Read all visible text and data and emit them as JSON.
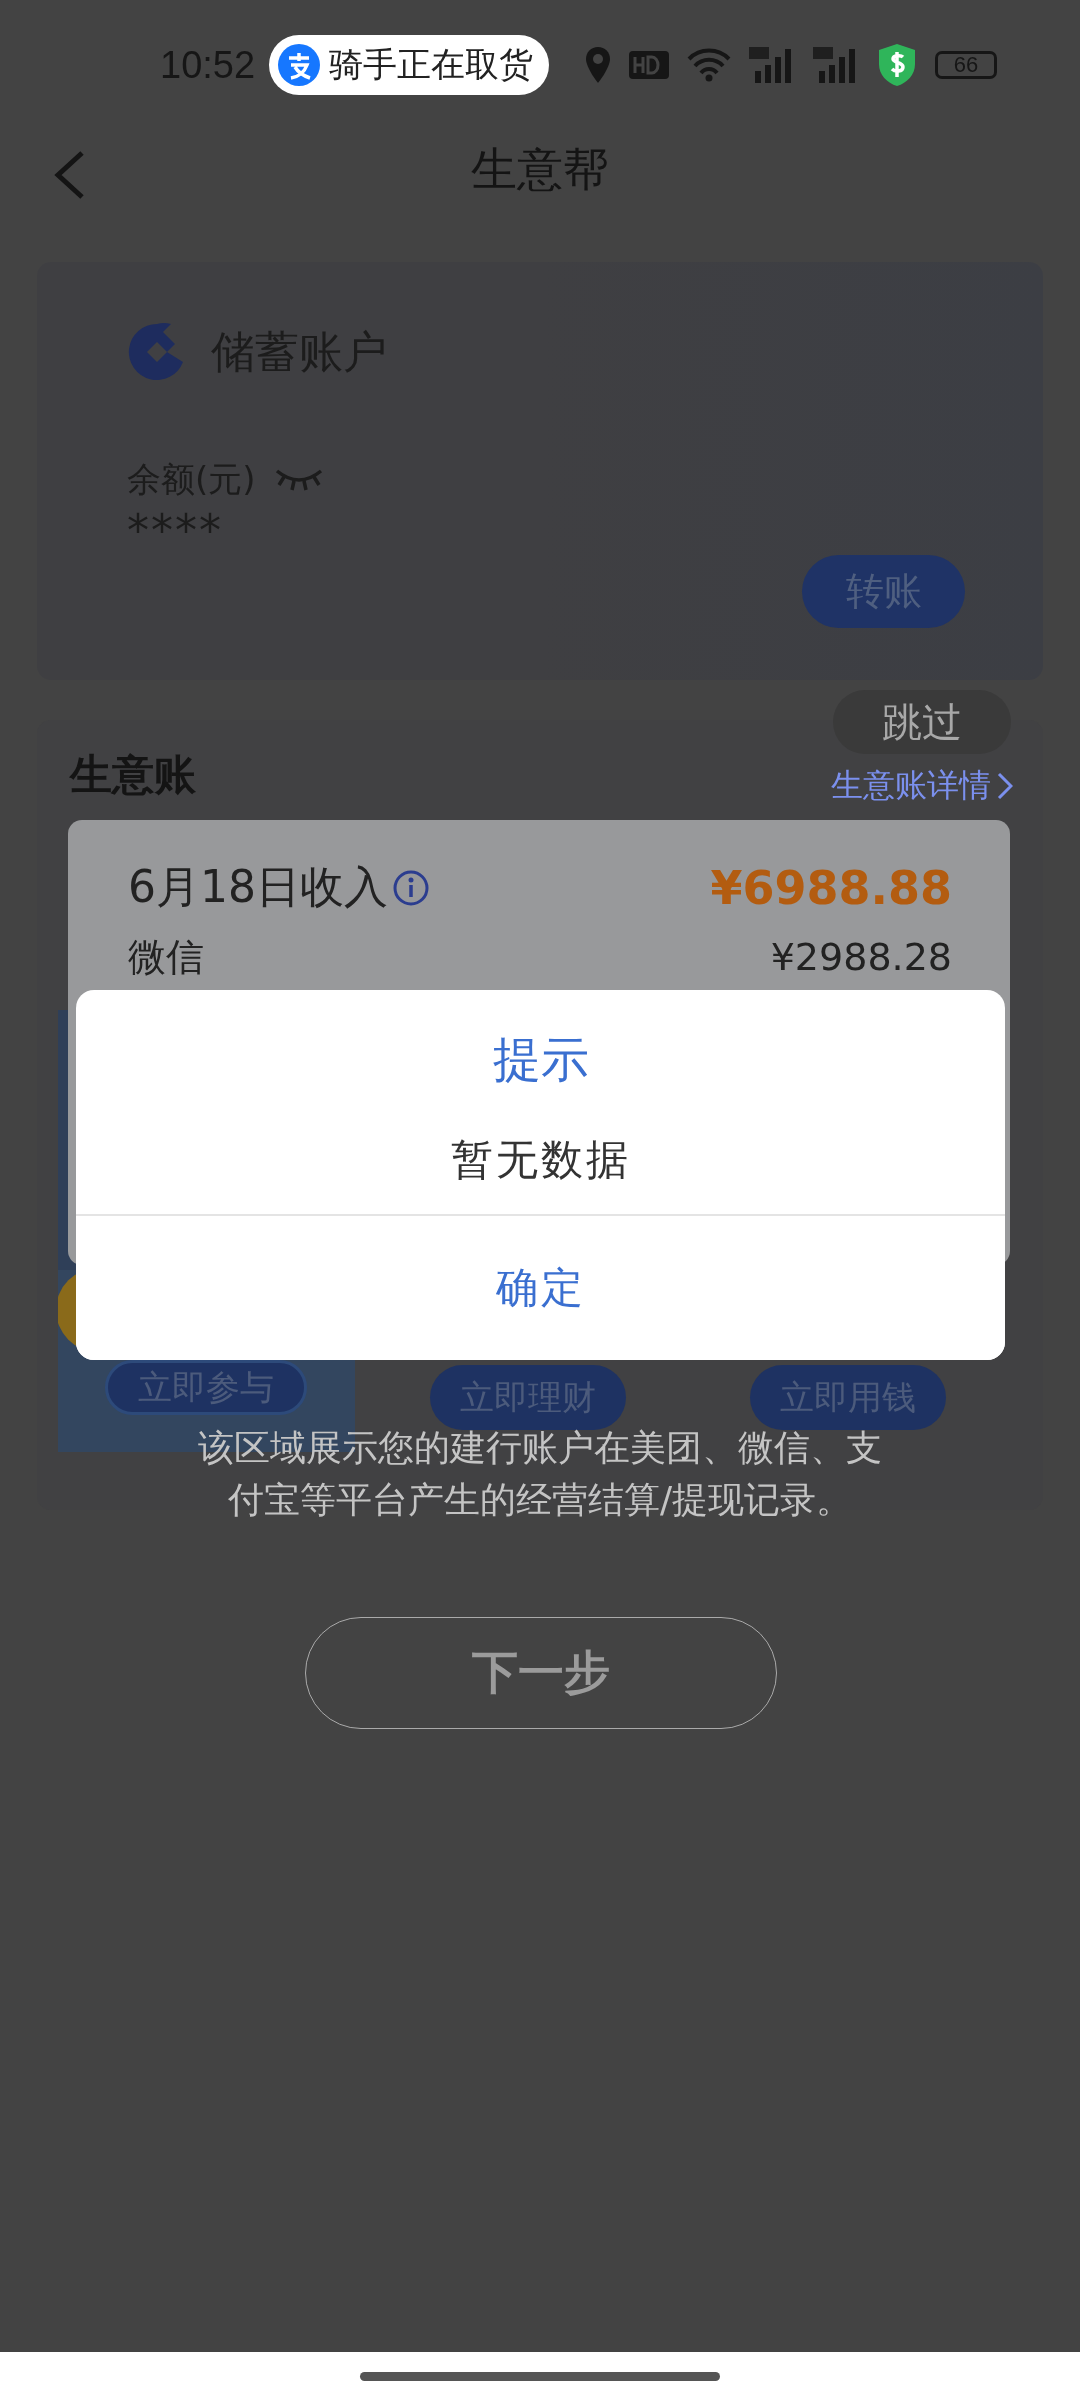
{
  "status_bar": {
    "time": "10:52",
    "notification": "骑手正在取货",
    "battery": "66"
  },
  "header": {
    "title": "生意帮"
  },
  "account_card": {
    "name": "储蓄账户",
    "balance_label": "余额(元)",
    "balance": "****",
    "transfer_button": "转账"
  },
  "ledger": {
    "title": "生意账",
    "details_link": "生意账详情",
    "promos": [
      {
        "kind": "banner",
        "button": "立即参与"
      },
      {
        "kind": "card",
        "button": "立即理财"
      },
      {
        "kind": "card",
        "button": "立即用钱"
      }
    ]
  },
  "guide": {
    "skip_button": "跳过",
    "highlight": {
      "date_label": "6月18日收入",
      "total": "¥6988.88",
      "rows": [
        {
          "label": "微信",
          "amount": "¥2988.28"
        }
      ]
    },
    "description": "该区域展示您的建行账户在美团、微信、支付宝等平台产生的经营结算/提现记录。",
    "next_button": "下一步"
  },
  "dialog": {
    "title": "提示",
    "message": "暂无数据",
    "confirm_button": "确定"
  }
}
